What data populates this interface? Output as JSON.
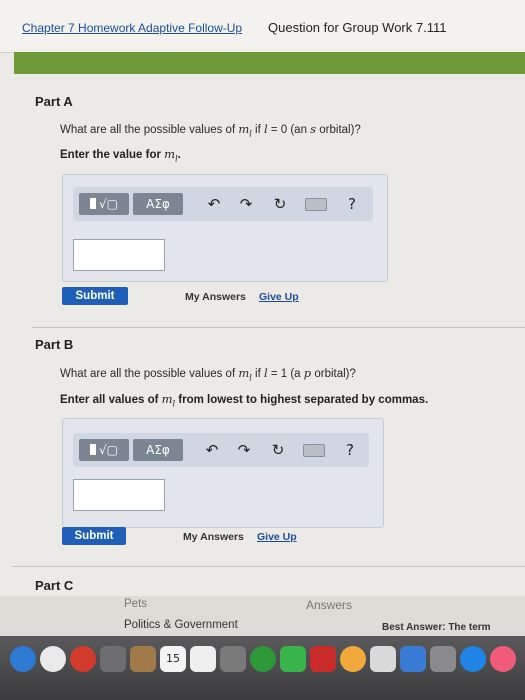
{
  "header": {
    "breadcrumb": "Chapter 7 Homework Adaptive Follow-Up",
    "title": "Question for Group Work 7.111"
  },
  "parts": [
    {
      "label": "Part A",
      "question_pre": "What are all the possible values of ",
      "question_var": "m",
      "question_var_sub": "l",
      "question_mid": " if ",
      "question_l": "l",
      "question_post": " = 0 (an ",
      "question_orb": "s",
      "question_end": " orbital)?",
      "instruction_pre": "Enter the value for ",
      "instruction_var": "m",
      "instruction_sub": "l",
      "instruction_post": ".",
      "toolbar": {
        "templates_label": "√▢",
        "symbols_label": "ΑΣφ",
        "undo_icon": "↶",
        "redo_icon": "↷",
        "reset_icon": "↻",
        "help_icon": "?"
      },
      "input_value": "",
      "submit_label": "Submit",
      "my_answers_label": "My Answers",
      "give_up_label": "Give Up"
    },
    {
      "label": "Part B",
      "question_pre": "What are all the possible values of ",
      "question_var": "m",
      "question_var_sub": "l",
      "question_mid": " if ",
      "question_l": "l",
      "question_post": " = 1 (a ",
      "question_orb": "p",
      "question_end": " orbital)?",
      "instruction_pre": "Enter all values of ",
      "instruction_var": "m",
      "instruction_sub": "l",
      "instruction_post": " from lowest to highest separated by commas.",
      "toolbar": {
        "templates_label": "√▢",
        "symbols_label": "ΑΣφ",
        "undo_icon": "↶",
        "redo_icon": "↷",
        "reset_icon": "↻",
        "help_icon": "?"
      },
      "input_value": "",
      "submit_label": "Submit",
      "my_answers_label": "My Answers",
      "give_up_label": "Give Up"
    },
    {
      "label": "Part C"
    }
  ],
  "background_page": {
    "left_items": [
      "Pets",
      "Politics & Government"
    ],
    "right_items": [
      "Answers",
      "Best Answer:  The term"
    ]
  },
  "dock": {
    "calendar_day": "15"
  },
  "colors": {
    "accent_bar": "#6f9a3a",
    "submit": "#1f5fb7",
    "link": "#1b4d9a"
  }
}
